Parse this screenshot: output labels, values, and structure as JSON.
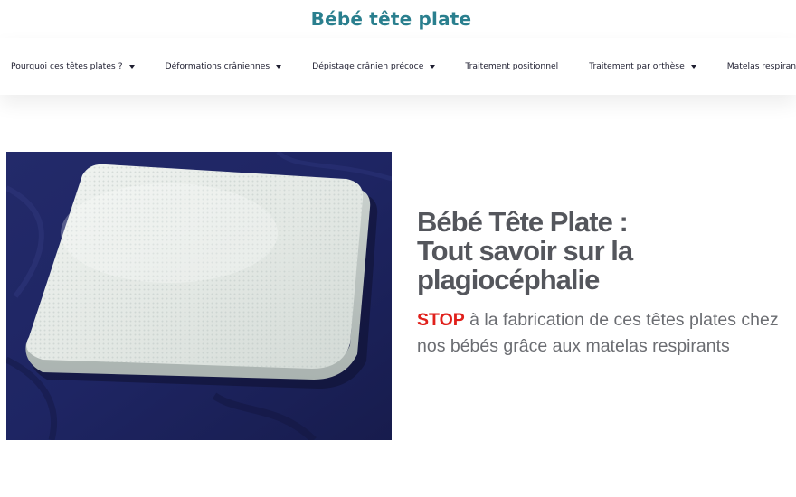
{
  "site": {
    "title": "Bébé tête plate",
    "brand_color": "#2a7f8e"
  },
  "nav": {
    "items": [
      {
        "label": "Pourquoi ces têtes plates ?",
        "has_dropdown": true
      },
      {
        "label": "Déformations crâniennes",
        "has_dropdown": true
      },
      {
        "label": "Dépistage crânien précoce",
        "has_dropdown": true
      },
      {
        "label": "Traitement positionnel",
        "has_dropdown": false
      },
      {
        "label": "Traitement par orthèse",
        "has_dropdown": true
      },
      {
        "label": "Matelas respirants",
        "has_dropdown": true
      }
    ],
    "dropdown_icon": "caret-down-icon"
  },
  "hero": {
    "image": {
      "subject": "breathable baby mattress on dark blue sheet"
    },
    "heading_lines": [
      "Bébé Tête Plate :",
      "Tout savoir sur la",
      "plagiocéphalie"
    ],
    "sub_highlight": "STOP",
    "sub_highlight_color": "#e0201b",
    "sub_rest": " à la fabrication de ces têtes plates chez nos bébés grâce aux matelas respirants"
  }
}
